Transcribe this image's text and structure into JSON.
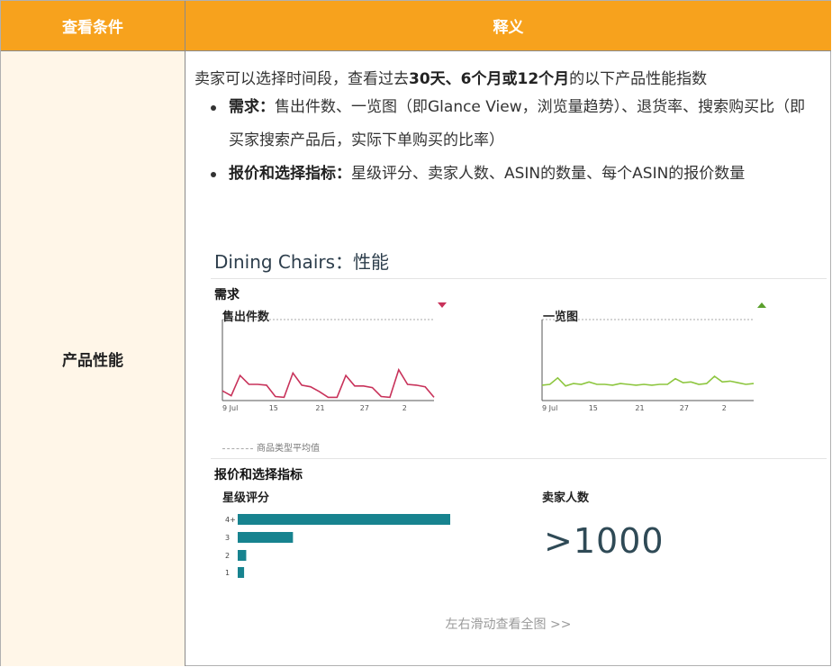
{
  "table": {
    "headers": {
      "left": "查看条件",
      "right": "释义"
    },
    "row_label": "产品性能",
    "intro": {
      "prefix": "卖家可以选择时间段，查看过去",
      "bold": "30天、6个月或12个月",
      "suffix": "的以下产品性能指数"
    },
    "bullets": [
      {
        "bold": "需求：",
        "text": "售出件数、一览图（即Glance View，浏览量趋势）、退货率、搜索购买比（即买家搜索产品后，实际下单购买的比率）"
      },
      {
        "bold": "报价和选择指标：",
        "text": "星级评分、卖家人数、ASIN的数量、每个ASIN的报价数量"
      }
    ],
    "footer": "左右滑动查看全图 >>"
  },
  "shot": {
    "title": "Dining Chairs：性能",
    "demand_section": "需求",
    "offers_section": "报价和选择指标",
    "legend": "商品类型平均值",
    "rating_title": "星级评分",
    "sellers_title": "卖家人数",
    "sellers_value": ">1000",
    "rating_labels": [
      "4+",
      "3",
      "2",
      "1"
    ]
  },
  "chart_data": [
    {
      "type": "line",
      "title": "售出件数",
      "trend": "down",
      "color": "#c8325a",
      "x_ticks": [
        "9 Jul",
        "15",
        "21",
        "27",
        "2"
      ],
      "values": [
        1.2,
        0.6,
        3.1,
        2.0,
        2.0,
        1.9,
        0.5,
        0.4,
        3.4,
        1.9,
        1.7,
        1.1,
        0.4,
        0.4,
        3.1,
        1.8,
        1.8,
        1.6,
        0.5,
        0.4,
        3.8,
        2.0,
        1.9,
        1.7,
        0.4
      ],
      "ylim": [
        0,
        10
      ]
    },
    {
      "type": "line",
      "title": "一览图",
      "trend": "up",
      "color": "#8dc63f",
      "x_ticks": [
        "9 Jul",
        "15",
        "21",
        "27",
        "2"
      ],
      "values": [
        1.9,
        2.0,
        2.8,
        1.8,
        2.1,
        2.0,
        2.3,
        2.0,
        2.0,
        1.9,
        2.1,
        2.0,
        1.9,
        2.0,
        1.9,
        2.0,
        2.0,
        2.7,
        2.2,
        2.3,
        2.0,
        2.1,
        3.0,
        2.3,
        2.4,
        2.2,
        2.0,
        2.1
      ],
      "ylim": [
        0,
        10
      ]
    },
    {
      "type": "bar",
      "title": "星级评分",
      "categories": [
        "4+",
        "3",
        "2",
        "1"
      ],
      "values": [
        100,
        26,
        4,
        3
      ],
      "color": "#17838f",
      "xlim": [
        0,
        100
      ]
    }
  ]
}
